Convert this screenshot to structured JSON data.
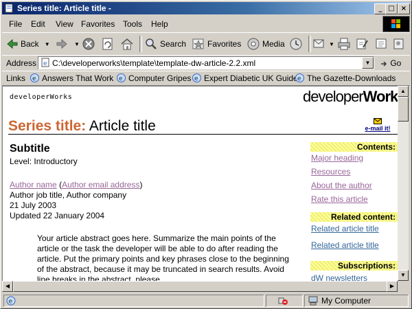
{
  "window": {
    "title": "Series title: Article title -",
    "minimize_label": "_",
    "maximize_label": "□",
    "close_label": "×"
  },
  "menu": {
    "items": [
      {
        "label": "File"
      },
      {
        "label": "Edit"
      },
      {
        "label": "View"
      },
      {
        "label": "Favorites"
      },
      {
        "label": "Tools"
      },
      {
        "label": "Help"
      }
    ]
  },
  "toolbar": {
    "back_label": "Back",
    "search_label": "Search",
    "favorites_label": "Favorites",
    "media_label": "Media"
  },
  "address": {
    "label": "Address",
    "value": "C:\\developerworks\\template\\template-dw-article-2.2.xml",
    "go_label": "Go"
  },
  "links": {
    "label": "Links",
    "items": [
      {
        "label": "Answers That Work"
      },
      {
        "label": "Computer Gripes"
      },
      {
        "label": "Expert Diabetic UK Guide"
      },
      {
        "label": "The Gazette-Downloads"
      }
    ]
  },
  "page": {
    "site_small": "developerWorks",
    "logo_light": "developer",
    "logo_bold": "Works",
    "series_title": "Series title:",
    "article_title": "Article title",
    "email_label": "e-mail it!",
    "subtitle": "Subtitle",
    "level": "Level: Introductory",
    "author_name": "Author name",
    "author_email": "Author email address",
    "author_paren_open": "(",
    "author_paren_close": ")",
    "author_job": "Author job title, Author company",
    "date": "21 July 2003",
    "updated": "Updated 22 January 2004",
    "abstract": "Your article abstract goes here. Summarize the main points of the article or the task the developer will be able to do after reading the article. Put the primary points and key phrases close to the beginning of the abstract, because it may be truncated in search results. Avoid line breaks in the abstract, please."
  },
  "sidebar": {
    "contents_header": "Contents:",
    "contents_links": [
      "Major heading",
      "Resources",
      "About the author",
      "Rate this article"
    ],
    "related_header": "Related content:",
    "related_links": [
      "Related article title",
      "Related article title"
    ],
    "subscriptions_header": "Subscriptions:",
    "subscriptions_links": [
      "dW newsletters"
    ]
  },
  "status": {
    "zone": "My Computer"
  }
}
